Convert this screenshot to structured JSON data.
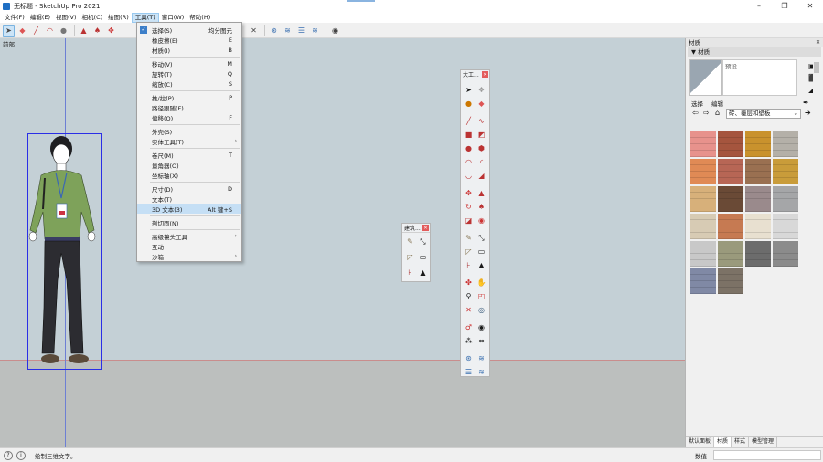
{
  "window": {
    "title": "无标题 - SketchUp Pro 2021",
    "minimize": "–",
    "maximize": "❐",
    "close": "✕"
  },
  "menubar": {
    "items": [
      {
        "label": "文件(F)"
      },
      {
        "label": "编辑(E)"
      },
      {
        "label": "视图(V)"
      },
      {
        "label": "相机(C)"
      },
      {
        "label": "绘图(R)"
      },
      {
        "label": "工具(T)",
        "active": true
      },
      {
        "label": "窗口(W)"
      },
      {
        "label": "帮助(H)"
      }
    ]
  },
  "scene": {
    "label": "前部"
  },
  "tools_menu": {
    "items": [
      {
        "label": "选择(S)",
        "shortcut": "均分图元",
        "checked": true
      },
      {
        "label": "橡皮擦(E)",
        "shortcut": "E"
      },
      {
        "label": "材质(I)",
        "shortcut": "B"
      },
      {
        "label": "移动(V)",
        "shortcut": "M"
      },
      {
        "label": "旋转(T)",
        "shortcut": "Q"
      },
      {
        "label": "缩放(C)",
        "shortcut": "S"
      },
      {
        "label": "推/拉(P)",
        "shortcut": "P"
      },
      {
        "label": "路径跟随(F)",
        "shortcut": ""
      },
      {
        "label": "偏移(O)",
        "shortcut": "F"
      },
      {
        "label": "外壳(S)",
        "shortcut": ""
      },
      {
        "label": "实体工具(T)",
        "shortcut": "",
        "submenu": true
      },
      {
        "label": "卷尺(M)",
        "shortcut": "T"
      },
      {
        "label": "量角器(O)",
        "shortcut": ""
      },
      {
        "label": "坐标轴(X)",
        "shortcut": ""
      },
      {
        "label": "尺寸(D)",
        "shortcut": "D"
      },
      {
        "label": "文本(T)",
        "shortcut": ""
      },
      {
        "label": "3D 文本(3)",
        "shortcut": "Alt 键+S",
        "highlighted": true
      },
      {
        "label": "剖切面(N)",
        "shortcut": ""
      },
      {
        "label": "高级镜头工具",
        "shortcut": "",
        "submenu": true
      },
      {
        "label": "互动",
        "shortcut": ""
      },
      {
        "label": "沙箱",
        "shortcut": "",
        "submenu": true
      }
    ]
  },
  "float_big": {
    "title": "大工..."
  },
  "float_small": {
    "title": "建筑..."
  },
  "tray": {
    "header": "材质",
    "panel_title": "材质",
    "material_name": "预设",
    "tab_select": "选择",
    "tab_edit": "编辑",
    "category": "砖、覆层和壁板",
    "bottom_tabs": [
      {
        "label": "默认面板"
      },
      {
        "label": "材质",
        "active": true
      },
      {
        "label": "样式"
      },
      {
        "label": "模型管理"
      }
    ],
    "swatches": [
      "#e7928c",
      "#a5553e",
      "#c9922d",
      "#b4b0a8",
      "#e08a55",
      "#b76655",
      "#9a7051",
      "#c99c3a",
      "#d7b07a",
      "#6a4a36",
      "#9a8a8c",
      "#a5a6a8",
      "#d7cbb4",
      "#c67a52",
      "#e8e0d0",
      "#d8d8d8",
      "#c8c8c8",
      "#9a9a7c",
      "#6c6c6c",
      "#8b8b8b",
      "#8089a5",
      "#7c7266"
    ]
  },
  "status": {
    "message": "绘制三维文字。",
    "measure_label": "数值"
  }
}
